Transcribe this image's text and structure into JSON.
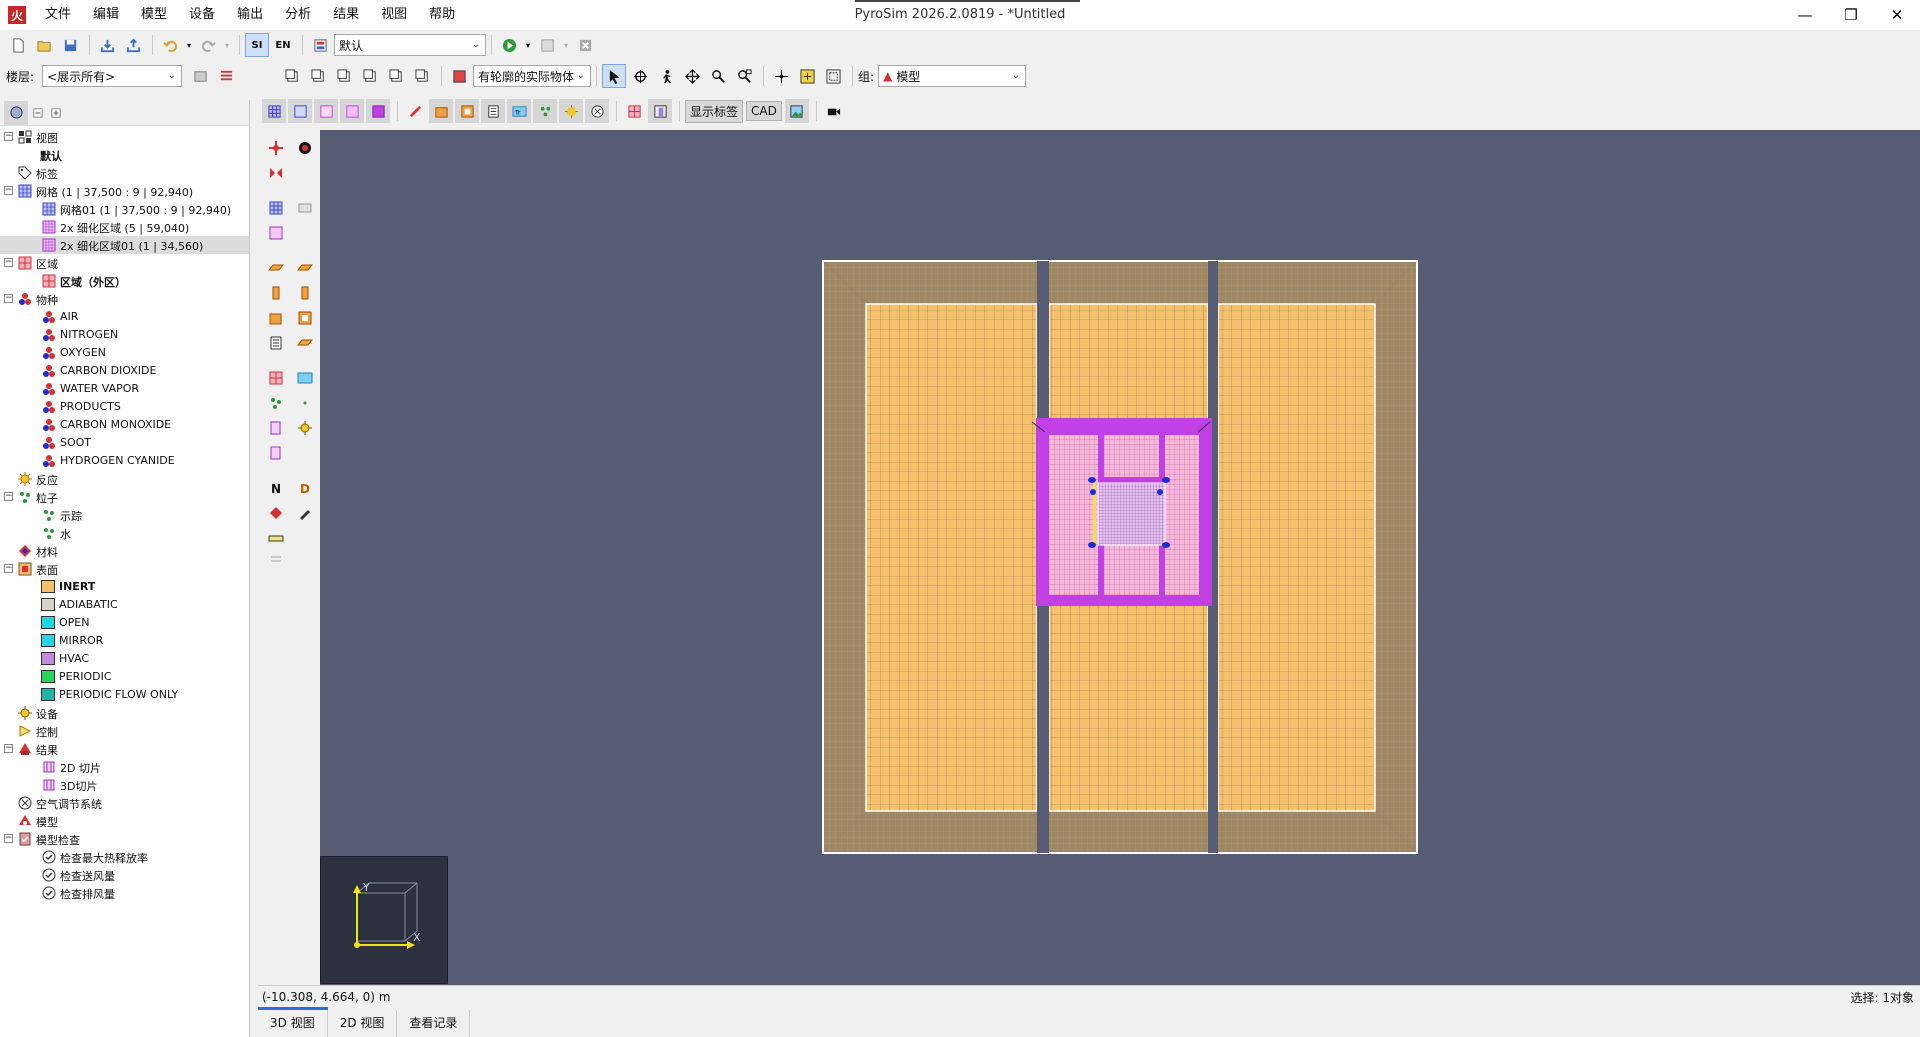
{
  "window": {
    "title": "PyroSim 2026.2.0819 - *Untitled",
    "app_icon_text": "火",
    "menu": [
      "文件",
      "编辑",
      "模型",
      "设备",
      "输出",
      "分析",
      "结果",
      "视图",
      "帮助"
    ]
  },
  "toolbar1": {
    "si_label": "SI",
    "en_label": "EN",
    "scenario_value": "默认"
  },
  "toolbar2": {
    "floor_label": "楼层:",
    "floor_value": "<展示所有>",
    "render_mode_value": "有轮廓的实际物体",
    "group_label": "组:",
    "group_value": "模型"
  },
  "toolbar3": {
    "show_labels": "显示标签",
    "cad": "CAD"
  },
  "tree": [
    {
      "label": "视图",
      "level": 0,
      "expander": "minus",
      "icon": "views-icon",
      "bold": false
    },
    {
      "label": "默认",
      "level": 1,
      "expander": "",
      "icon": "",
      "bold": true
    },
    {
      "label": "标签",
      "level": 0,
      "expander": "",
      "icon": "tag-icon",
      "bold": false
    },
    {
      "label": "网格 (1 | 37,500 : 9 | 92,940)",
      "level": 0,
      "expander": "minus",
      "icon": "mesh-icon",
      "bold": false
    },
    {
      "label": "网格01 (1 | 37,500 : 9 | 92,940)",
      "level": 1,
      "expander": "",
      "icon": "mesh-icon",
      "bold": false
    },
    {
      "label": "2x 细化区域 (5 | 59,040)",
      "level": 1,
      "expander": "",
      "icon": "refine-icon",
      "bold": false
    },
    {
      "label": "2x 细化区域01 (1 | 34,560)",
      "level": 1,
      "expander": "",
      "icon": "refine-icon",
      "bold": false,
      "selected": true
    },
    {
      "label": "区域",
      "level": 0,
      "expander": "minus",
      "icon": "zone-icon",
      "bold": false
    },
    {
      "label": "区域（外区）",
      "level": 1,
      "expander": "",
      "icon": "zone-icon",
      "bold": true
    },
    {
      "label": "物种",
      "level": 0,
      "expander": "minus",
      "icon": "species-icon",
      "bold": false
    },
    {
      "label": "AIR",
      "level": 1,
      "expander": "",
      "icon": "species-icon",
      "bold": false
    },
    {
      "label": "NITROGEN",
      "level": 1,
      "expander": "",
      "icon": "species-icon",
      "bold": false
    },
    {
      "label": "OXYGEN",
      "level": 1,
      "expander": "",
      "icon": "species-icon",
      "bold": false
    },
    {
      "label": "CARBON DIOXIDE",
      "level": 1,
      "expander": "",
      "icon": "species-icon",
      "bold": false
    },
    {
      "label": "WATER VAPOR",
      "level": 1,
      "expander": "",
      "icon": "species-icon",
      "bold": false
    },
    {
      "label": "PRODUCTS",
      "level": 1,
      "expander": "",
      "icon": "species-icon",
      "bold": false
    },
    {
      "label": "CARBON MONOXIDE",
      "level": 1,
      "expander": "",
      "icon": "species-icon",
      "bold": false
    },
    {
      "label": "SOOT",
      "level": 1,
      "expander": "",
      "icon": "species-icon",
      "bold": false
    },
    {
      "label": "HYDROGEN CYANIDE",
      "level": 1,
      "expander": "",
      "icon": "species-icon",
      "bold": false
    },
    {
      "label": "反应",
      "level": 0,
      "expander": "",
      "icon": "reaction-icon",
      "bold": false
    },
    {
      "label": "粒子",
      "level": 0,
      "expander": "minus",
      "icon": "particle-icon",
      "bold": false
    },
    {
      "label": "示踪",
      "level": 1,
      "expander": "",
      "icon": "particle-icon",
      "bold": false
    },
    {
      "label": "水",
      "level": 1,
      "expander": "",
      "icon": "particle-icon",
      "bold": false
    },
    {
      "label": "材料",
      "level": 0,
      "expander": "",
      "icon": "material-icon",
      "bold": false
    },
    {
      "label": "表面",
      "level": 0,
      "expander": "minus",
      "icon": "surface-icon",
      "bold": false
    },
    {
      "label": "INERT",
      "level": 1,
      "expander": "",
      "icon": "swatch",
      "color": "#f5c16c",
      "bold": true
    },
    {
      "label": "ADIABATIC",
      "level": 1,
      "expander": "",
      "icon": "swatch",
      "color": "#d9d4c6",
      "bold": false
    },
    {
      "label": "OPEN",
      "level": 1,
      "expander": "",
      "icon": "swatch",
      "color": "#22d6e0",
      "bold": false
    },
    {
      "label": "MIRROR",
      "level": 1,
      "expander": "",
      "icon": "swatch",
      "color": "#22d6e0",
      "bold": false
    },
    {
      "label": "HVAC",
      "level": 1,
      "expander": "",
      "icon": "swatch",
      "color": "#c58be3",
      "bold": false
    },
    {
      "label": "PERIODIC",
      "level": 1,
      "expander": "",
      "icon": "swatch",
      "color": "#2ad45a",
      "bold": false
    },
    {
      "label": "PERIODIC FLOW ONLY",
      "level": 1,
      "expander": "",
      "icon": "swatch",
      "color": "#1fb4a8",
      "bold": false
    },
    {
      "label": "设备",
      "level": 0,
      "expander": "",
      "icon": "device-icon",
      "bold": false
    },
    {
      "label": "控制",
      "level": 0,
      "expander": "",
      "icon": "control-icon",
      "bold": false
    },
    {
      "label": "结果",
      "level": 0,
      "expander": "minus",
      "icon": "results-icon",
      "bold": false
    },
    {
      "label": "2D 切片",
      "level": 1,
      "expander": "",
      "icon": "slice-icon",
      "bold": false
    },
    {
      "label": "3D切片",
      "level": 1,
      "expander": "",
      "icon": "slice-icon",
      "bold": false
    },
    {
      "label": "空气调节系统",
      "level": 0,
      "expander": "",
      "icon": "hvac-icon",
      "bold": false
    },
    {
      "label": "模型",
      "level": 0,
      "expander": "",
      "icon": "model-icon",
      "bold": false
    },
    {
      "label": "模型检查",
      "level": 0,
      "expander": "minus",
      "icon": "check-icon",
      "bold": false
    },
    {
      "label": "检查最大热释放率",
      "level": 1,
      "expander": "",
      "icon": "checkmark-icon",
      "bold": false
    },
    {
      "label": "检查送风量",
      "level": 1,
      "expander": "",
      "icon": "checkmark-icon",
      "bold": false
    },
    {
      "label": "检查排风量",
      "level": 1,
      "expander": "",
      "icon": "checkmark-icon",
      "bold": false
    }
  ],
  "viewport": {
    "background": "#555c73",
    "floor_color": "#f5c16c",
    "wall_color": "#9c8866",
    "refine_color": "#c040e6",
    "axis_x": "X",
    "axis_y": "Y"
  },
  "status": {
    "coordinates": "(-10.308, 4.664, 0) m",
    "selection": "选择:    1对象"
  },
  "bottom_tabs": [
    "3D 视图",
    "2D 视图",
    "查看记录"
  ]
}
